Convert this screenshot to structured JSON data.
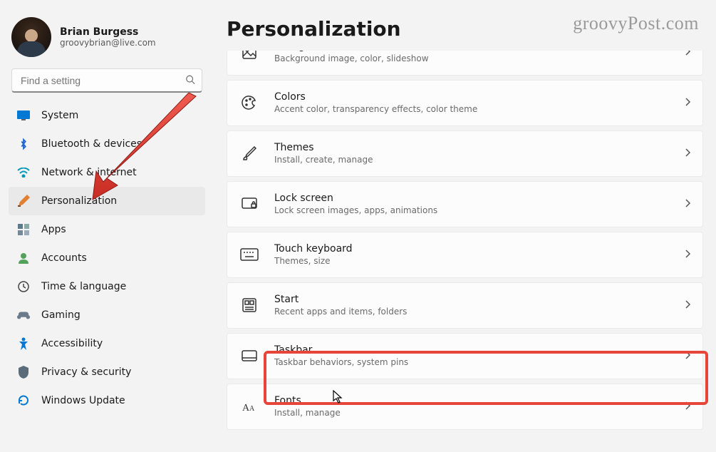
{
  "watermark": "groovyPost.com",
  "user": {
    "name": "Brian Burgess",
    "email": "groovybrian@live.com"
  },
  "search": {
    "placeholder": "Find a setting"
  },
  "nav": [
    {
      "key": "system",
      "label": "System",
      "icon": "system-icon",
      "color": "#0078d4"
    },
    {
      "key": "bluetooth",
      "label": "Bluetooth & devices",
      "icon": "bluetooth-icon",
      "color": "#1e66d0"
    },
    {
      "key": "network",
      "label": "Network & internet",
      "icon": "wifi-icon",
      "color": "#0099bc"
    },
    {
      "key": "personalization",
      "label": "Personalization",
      "icon": "paint-icon",
      "color": "#e08030",
      "selected": true
    },
    {
      "key": "apps",
      "label": "Apps",
      "icon": "apps-icon",
      "color": "#5b7a8c"
    },
    {
      "key": "accounts",
      "label": "Accounts",
      "icon": "person-icon",
      "color": "#53a15a"
    },
    {
      "key": "time",
      "label": "Time & language",
      "icon": "clock-icon",
      "color": "#444"
    },
    {
      "key": "gaming",
      "label": "Gaming",
      "icon": "gaming-icon",
      "color": "#6c7b8b"
    },
    {
      "key": "accessibility",
      "label": "Accessibility",
      "icon": "accessibility-icon",
      "color": "#0078d4"
    },
    {
      "key": "privacy",
      "label": "Privacy & security",
      "icon": "shield-icon",
      "color": "#5a6b7a"
    },
    {
      "key": "update",
      "label": "Windows Update",
      "icon": "update-icon",
      "color": "#0078d4"
    }
  ],
  "page": {
    "title": "Personalization"
  },
  "cards": [
    {
      "key": "background",
      "title": "Background",
      "desc": "Background image, color, slideshow",
      "icon": "image-icon",
      "truncated_top": true
    },
    {
      "key": "colors",
      "title": "Colors",
      "desc": "Accent color, transparency effects, color theme",
      "icon": "palette-icon"
    },
    {
      "key": "themes",
      "title": "Themes",
      "desc": "Install, create, manage",
      "icon": "brush-icon"
    },
    {
      "key": "lockscreen",
      "title": "Lock screen",
      "desc": "Lock screen images, apps, animations",
      "icon": "lock-screen-icon"
    },
    {
      "key": "touchkb",
      "title": "Touch keyboard",
      "desc": "Themes, size",
      "icon": "keyboard-icon"
    },
    {
      "key": "start",
      "title": "Start",
      "desc": "Recent apps and items, folders",
      "icon": "start-icon"
    },
    {
      "key": "taskbar",
      "title": "Taskbar",
      "desc": "Taskbar behaviors, system pins",
      "icon": "taskbar-icon",
      "highlighted": true
    },
    {
      "key": "fonts",
      "title": "Fonts",
      "desc": "Install, manage",
      "icon": "fonts-icon"
    }
  ]
}
